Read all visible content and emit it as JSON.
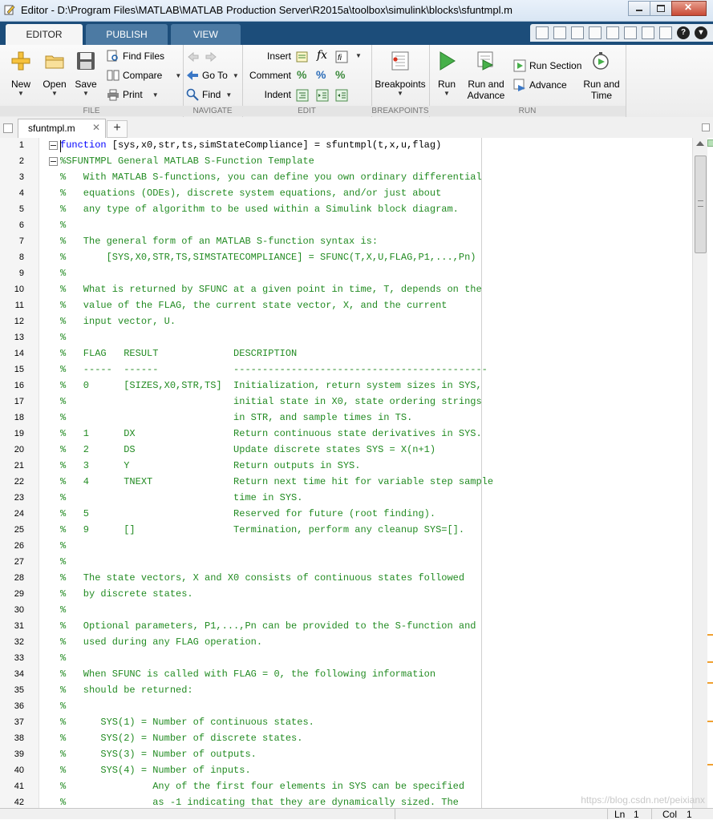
{
  "window": {
    "title": "Editor - D:\\Program Files\\MATLAB\\MATLAB Production Server\\R2015a\\toolbox\\simulink\\blocks\\sfuntmpl.m"
  },
  "ribbon_tabs": [
    "EDITOR",
    "PUBLISH",
    "VIEW"
  ],
  "ribbon": {
    "file": {
      "title": "FILE",
      "new": "New",
      "open": "Open",
      "save": "Save",
      "find_files": "Find Files",
      "compare": "Compare",
      "print": "Print"
    },
    "navigate": {
      "title": "NAVIGATE",
      "goto": "Go To",
      "find": "Find"
    },
    "edit": {
      "title": "EDIT",
      "insert": "Insert",
      "comment": "Comment",
      "indent": "Indent",
      "fx": "fx"
    },
    "breakpoints": {
      "title": "BREAKPOINTS",
      "label": "Breakpoints"
    },
    "run": {
      "title": "RUN",
      "run": "Run",
      "run_and_advance_1": "Run and",
      "run_and_advance_2": "Advance",
      "run_section": "Run Section",
      "advance": "Advance",
      "run_and_time_1": "Run and",
      "run_and_time_2": "Time"
    }
  },
  "document_tab": {
    "name": "sfuntmpl.m",
    "close": "✕",
    "new": "+"
  },
  "code_lines": [
    {
      "n": "1",
      "kw": "function",
      "text": " [sys,x0,str,ts,simStateCompliance] = sfuntmpl(t,x,u,flag)",
      "type": "fn",
      "fold": true
    },
    {
      "n": "2",
      "text": "%SFUNTMPL General MATLAB S-Function Template",
      "type": "c",
      "fold": true
    },
    {
      "n": "3",
      "text": "%   With MATLAB S-functions, you can define you own ordinary differential",
      "type": "c"
    },
    {
      "n": "4",
      "text": "%   equations (ODEs), discrete system equations, and/or just about",
      "type": "c"
    },
    {
      "n": "5",
      "text": "%   any type of algorithm to be used within a Simulink block diagram.",
      "type": "c"
    },
    {
      "n": "6",
      "text": "%",
      "type": "c"
    },
    {
      "n": "7",
      "text": "%   The general form of an MATLAB S-function syntax is:",
      "type": "c"
    },
    {
      "n": "8",
      "text": "%       [SYS,X0,STR,TS,SIMSTATECOMPLIANCE] = SFUNC(T,X,U,FLAG,P1,...,Pn)",
      "type": "c"
    },
    {
      "n": "9",
      "text": "%",
      "type": "c"
    },
    {
      "n": "10",
      "text": "%   What is returned by SFUNC at a given point in time, T, depends on the",
      "type": "c"
    },
    {
      "n": "11",
      "text": "%   value of the FLAG, the current state vector, X, and the current",
      "type": "c"
    },
    {
      "n": "12",
      "text": "%   input vector, U.",
      "type": "c"
    },
    {
      "n": "13",
      "text": "%",
      "type": "c"
    },
    {
      "n": "14",
      "text": "%   FLAG   RESULT             DESCRIPTION",
      "type": "c"
    },
    {
      "n": "15",
      "text": "%   -----  ------             --------------------------------------------",
      "type": "c"
    },
    {
      "n": "16",
      "text": "%   0      [SIZES,X0,STR,TS]  Initialization, return system sizes in SYS,",
      "type": "c"
    },
    {
      "n": "17",
      "text": "%                             initial state in X0, state ordering strings",
      "type": "c"
    },
    {
      "n": "18",
      "text": "%                             in STR, and sample times in TS.",
      "type": "c"
    },
    {
      "n": "19",
      "text": "%   1      DX                 Return continuous state derivatives in SYS.",
      "type": "c"
    },
    {
      "n": "20",
      "text": "%   2      DS                 Update discrete states SYS = X(n+1)",
      "type": "c"
    },
    {
      "n": "21",
      "text": "%   3      Y                  Return outputs in SYS.",
      "type": "c"
    },
    {
      "n": "22",
      "text": "%   4      TNEXT              Return next time hit for variable step sample",
      "type": "c"
    },
    {
      "n": "23",
      "text": "%                             time in SYS.",
      "type": "c"
    },
    {
      "n": "24",
      "text": "%   5                         Reserved for future (root finding).",
      "type": "c"
    },
    {
      "n": "25",
      "text": "%   9      []                 Termination, perform any cleanup SYS=[].",
      "type": "c"
    },
    {
      "n": "26",
      "text": "%",
      "type": "c"
    },
    {
      "n": "27",
      "text": "%",
      "type": "c"
    },
    {
      "n": "28",
      "text": "%   The state vectors, X and X0 consists of continuous states followed",
      "type": "c"
    },
    {
      "n": "29",
      "text": "%   by discrete states.",
      "type": "c"
    },
    {
      "n": "30",
      "text": "%",
      "type": "c"
    },
    {
      "n": "31",
      "text": "%   Optional parameters, P1,...,Pn can be provided to the S-function and",
      "type": "c"
    },
    {
      "n": "32",
      "text": "%   used during any FLAG operation.",
      "type": "c"
    },
    {
      "n": "33",
      "text": "%",
      "type": "c"
    },
    {
      "n": "34",
      "text": "%   When SFUNC is called with FLAG = 0, the following information",
      "type": "c"
    },
    {
      "n": "35",
      "text": "%   should be returned:",
      "type": "c"
    },
    {
      "n": "36",
      "text": "%",
      "type": "c"
    },
    {
      "n": "37",
      "text": "%      SYS(1) = Number of continuous states.",
      "type": "c"
    },
    {
      "n": "38",
      "text": "%      SYS(2) = Number of discrete states.",
      "type": "c"
    },
    {
      "n": "39",
      "text": "%      SYS(3) = Number of outputs.",
      "type": "c"
    },
    {
      "n": "40",
      "text": "%      SYS(4) = Number of inputs.",
      "type": "c"
    },
    {
      "n": "41",
      "text": "%               Any of the first four elements in SYS can be specified",
      "type": "c"
    },
    {
      "n": "42",
      "text": "%               as -1 indicating that they are dynamically sized. The",
      "type": "c"
    }
  ],
  "status": {
    "ln_label": "Ln",
    "ln_value": "1",
    "col_label": "Col",
    "col_value": "1"
  },
  "watermark": "https://blog.csdn.net/peixianx",
  "colors": {
    "comment": "#228b22",
    "keyword": "#0000ff",
    "tabstrip": "#1c4d7a"
  }
}
